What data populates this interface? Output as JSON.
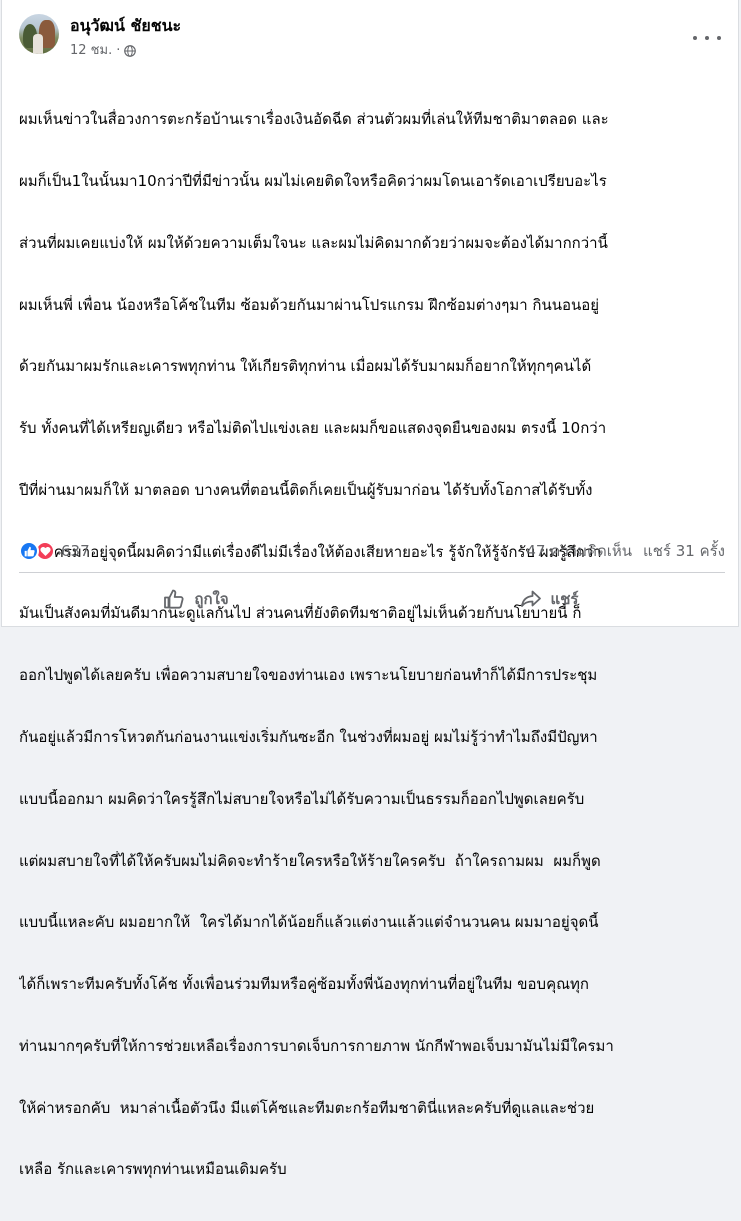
{
  "post": {
    "author": "อนุวัฒน์ ชัยชนะ",
    "time": "12 ชม.",
    "dot": "·",
    "lines": [
      "ผมเห็นข่าวในสื่อวงการตะกร้อบ้านเราเรื่องเงินอัดฉีด ส่วนตัวผมที่เล่นให้ทีมชาติมาตลอด และ",
      "ผมก็เป็น1ในนั้นมา10กว่าปีที่มีข่าวนั้น ผมไม่เคยติดใจหรือคิดว่าผมโดนเอารัดเอาเปรียบอะไร",
      "ส่วนที่ผมเคยแบ่งให้ ผมให้ด้วยความเต็มใจนะ และผมไม่คิดมากด้วยว่าผมจะต้องได้มากกว่านี้",
      "ผมเห็นพี่ เพื่อน น้องหรือโค้ชในทีม ซ้อมด้วยกันมาผ่านโปรแกรม ฝึกซ้อมต่างๆมา กินนอนอยู่",
      "ด้วยกันมาผมรักและเคารพทุกท่าน ให้เกียรติทุกท่าน เมื่อผมได้รับมาผมก็อยากให้ทุกๆคนได้",
      "รับ ทั้งคนที่ได้เหรียญเดียว หรือไม่ติดไปแข่งเลย และผมก็ขอแสดงจุดยืนของผม ตรงนี้ 10กว่า",
      "ปีที่ผ่านมาผมก็ให้ มาตลอด บางคนที่ตอนนี้ติดก็เคยเป็นผู้รับมาก่อน ได้รับทั้งโอกาสได้รับทั้ง",
      "เงิน ใครมาอยู่จุดนี้ผมคิดว่ามีแต่เรื่องดีไม่มีเรื่องให้ต้องเสียหายอะไร รู้จักให้รู้จักรับ ผมรู้สึกว่า",
      "มันเป็นสังคมที่มันดีมากนะดูแลกันไป ส่วนคนที่ยังติดทีมชาติอยู่ไม่เห็นด้วยกับนโยบายนี้ ก็",
      "ออกไปพูดได้เลยครับ เพื่อความสบายใจของท่านเอง เพราะนโยบายก่อนทำก็ได้มีการประชุม",
      "กันอยู่แล้วมีการโหวตกันก่อนงานแข่งเริ่มกันซะอีก ในช่วงที่ผมอยู่ ผมไม่รู้ว่าทำไมถึงมีปัญหา",
      "แบบนี้ออกมา ผมคิดว่าใครรู้สึกไม่สบายใจหรือไม่ได้รับความเป็นธรรมก็ออกไปพูดเลยครับ",
      "แต่ผมสบายใจที่ได้ให้ครับผมไม่คิดจะทำร้ายใครหรือให้ร้ายใครครับ  ถ้าใครถามผม  ผมก็พูด",
      "แบบนี้แหละคับ ผมอยากให้  ใครได้มากได้น้อยก็แล้วแต่งานแล้วแต่จำนวนคน ผมมาอยู่จุดนี้",
      "ได้ก็เพราะทีมครับทั้งโค้ช ทั้งเพื่อนร่วมทีมหรือคู่ซ้อมทั้งพี่น้องทุกท่านที่อยู่ในทีม ขอบคุณทุก",
      "ท่านมากๆครับที่ให้การช่วยเหลือเรื่องการบาดเจ็บการกายภาพ นักกีฬาพอเจ็บมามันไม่มีใครมา",
      "ให้ค่าหรอกคับ  หมาล่าเนื้อตัวนึง มีแต่โค้ชและทีมตะกร้อทีมชาตินี่แหละครับที่ดูแลและช่วย",
      "เหลือ รักและเคารพทุกท่านเหมือนเดิมครับ"
    ]
  },
  "stats": {
    "reactions_count": "637",
    "comments": "47 ความคิดเห็น",
    "shares": "แชร์ 31 ครั้ง"
  },
  "actions": {
    "like": "ถูกใจ",
    "share": "แชร์"
  },
  "icons": {
    "reaction_like": "thumbs-up-icon",
    "reaction_love": "heart-icon",
    "privacy": "globe-icon",
    "more": "more-options-icon",
    "like_action": "thumbs-up-outline-icon",
    "share_action": "share-arrow-icon"
  },
  "colors": {
    "like_blue": "#1877f2",
    "love_red": "#f33e58",
    "secondary_text": "#65676b"
  }
}
